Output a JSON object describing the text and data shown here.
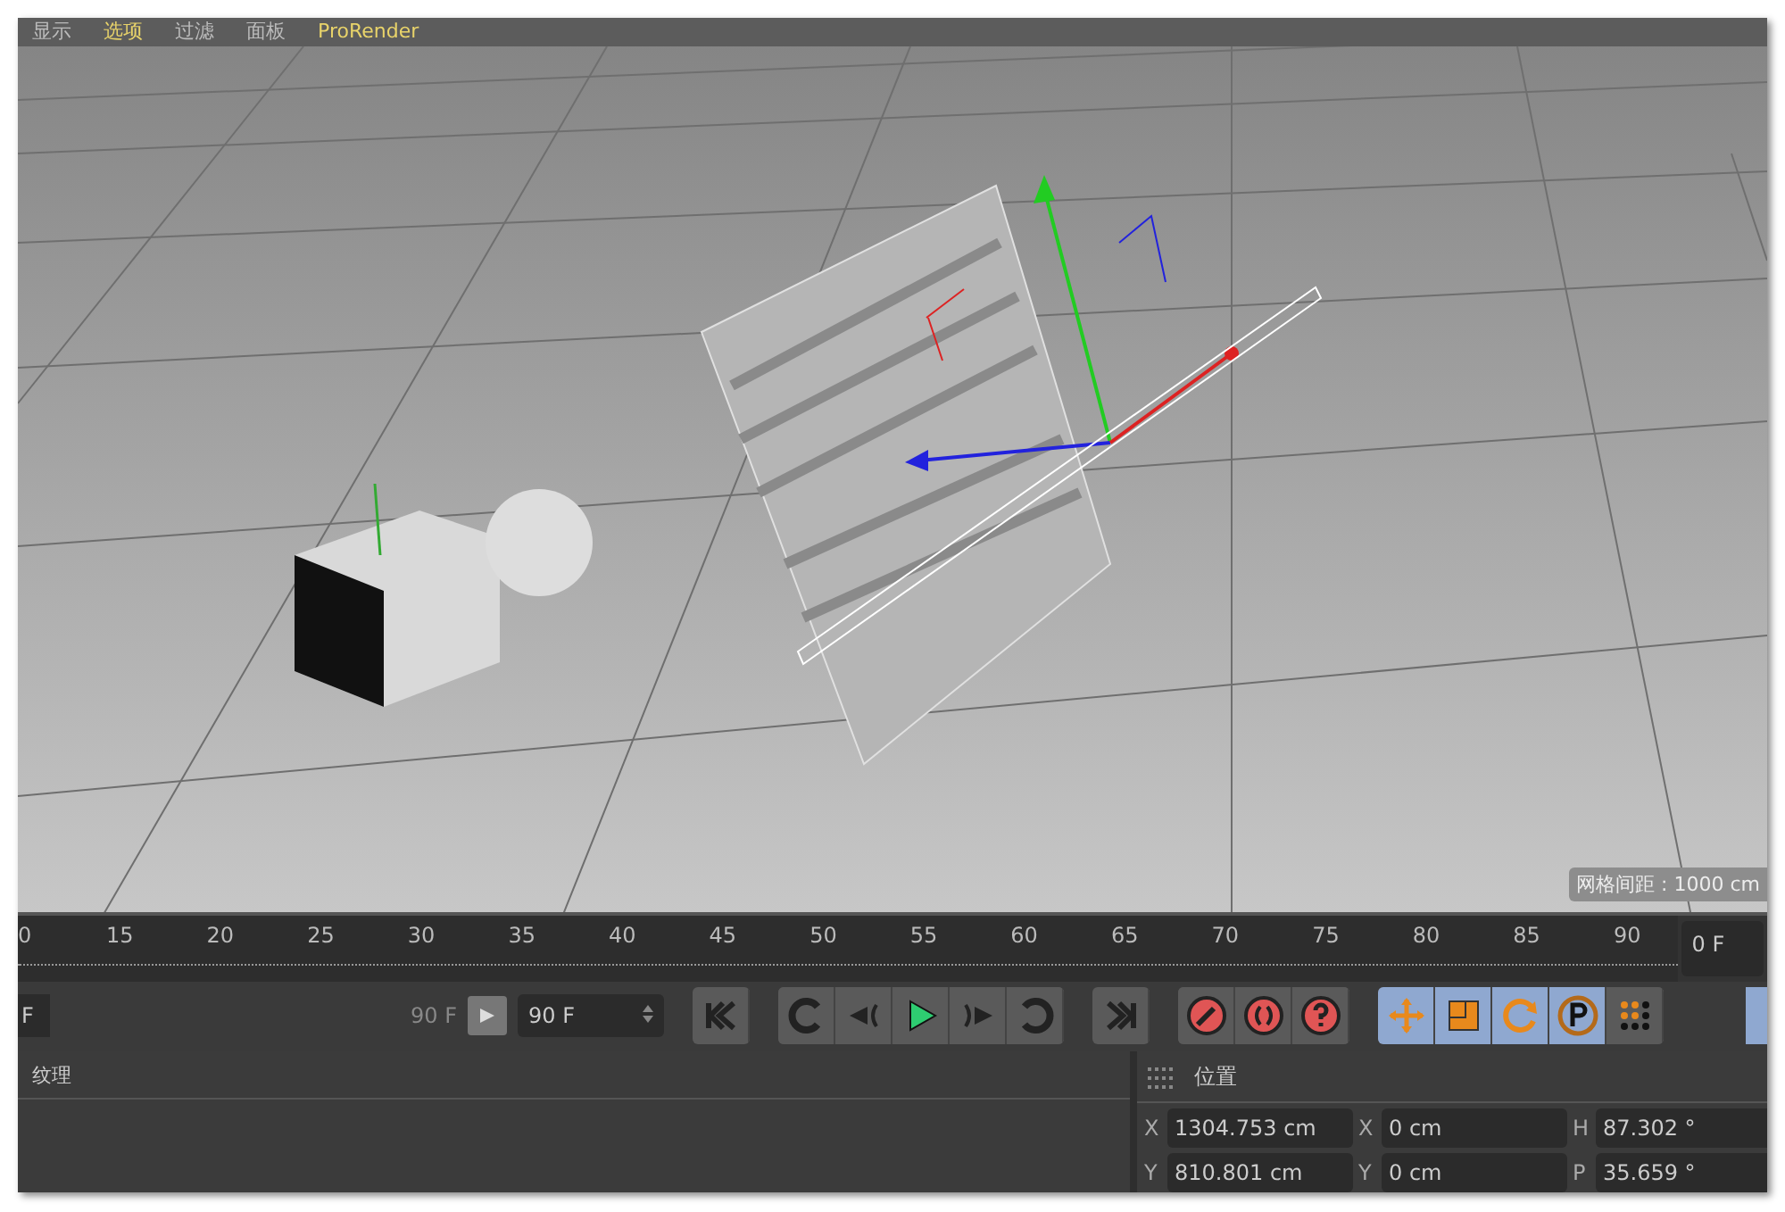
{
  "menu": [
    {
      "label": "显示",
      "highlighted": false
    },
    {
      "label": "选项",
      "highlighted": true
    },
    {
      "label": "过滤",
      "highlighted": false
    },
    {
      "label": "面板",
      "highlighted": false
    },
    {
      "label": "ProRender",
      "highlighted": true
    }
  ],
  "viewport": {
    "grid_spacing": "网格间距 : 1000 cm"
  },
  "timeline": {
    "ticks": [
      "0",
      "15",
      "20",
      "25",
      "30",
      "35",
      "40",
      "45",
      "50",
      "55",
      "60",
      "65",
      "70",
      "75",
      "80",
      "85",
      "90"
    ],
    "current_frame": "0 F"
  },
  "transport": {
    "start_field": "F",
    "end_label": "90 F",
    "range_field": "90 F",
    "groups": [
      [
        {
          "kind": "start",
          "on": false
        }
      ],
      [
        {
          "kind": "prev-key",
          "on": false
        },
        {
          "kind": "step-back",
          "on": false
        },
        {
          "kind": "play",
          "on": false
        },
        {
          "kind": "step-forward",
          "on": false
        },
        {
          "kind": "next-key",
          "on": false
        }
      ],
      [
        {
          "kind": "end",
          "on": false
        }
      ],
      [
        {
          "kind": "record",
          "on": false
        },
        {
          "kind": "autokey",
          "on": false
        },
        {
          "kind": "keyset",
          "on": false
        }
      ],
      [
        {
          "kind": "move",
          "on": true
        },
        {
          "kind": "scale",
          "on": true
        },
        {
          "kind": "rotate",
          "on": true
        },
        {
          "kind": "param",
          "on": true
        },
        {
          "kind": "dots",
          "on": false
        }
      ]
    ]
  },
  "attributes": {
    "tabs": [
      {
        "label": "纹理",
        "selected": false
      }
    ]
  },
  "coordinates": {
    "title": "位置",
    "rows": [
      [
        {
          "axis": "X",
          "value": "1304.753 cm"
        },
        {
          "axis": "X",
          "value": "0 cm"
        },
        {
          "axis": "H",
          "value": "87.302 °"
        }
      ],
      [
        {
          "axis": "Y",
          "value": "810.801 cm"
        },
        {
          "axis": "Y",
          "value": "0 cm"
        },
        {
          "axis": "P",
          "value": "35.659 °"
        }
      ]
    ]
  }
}
